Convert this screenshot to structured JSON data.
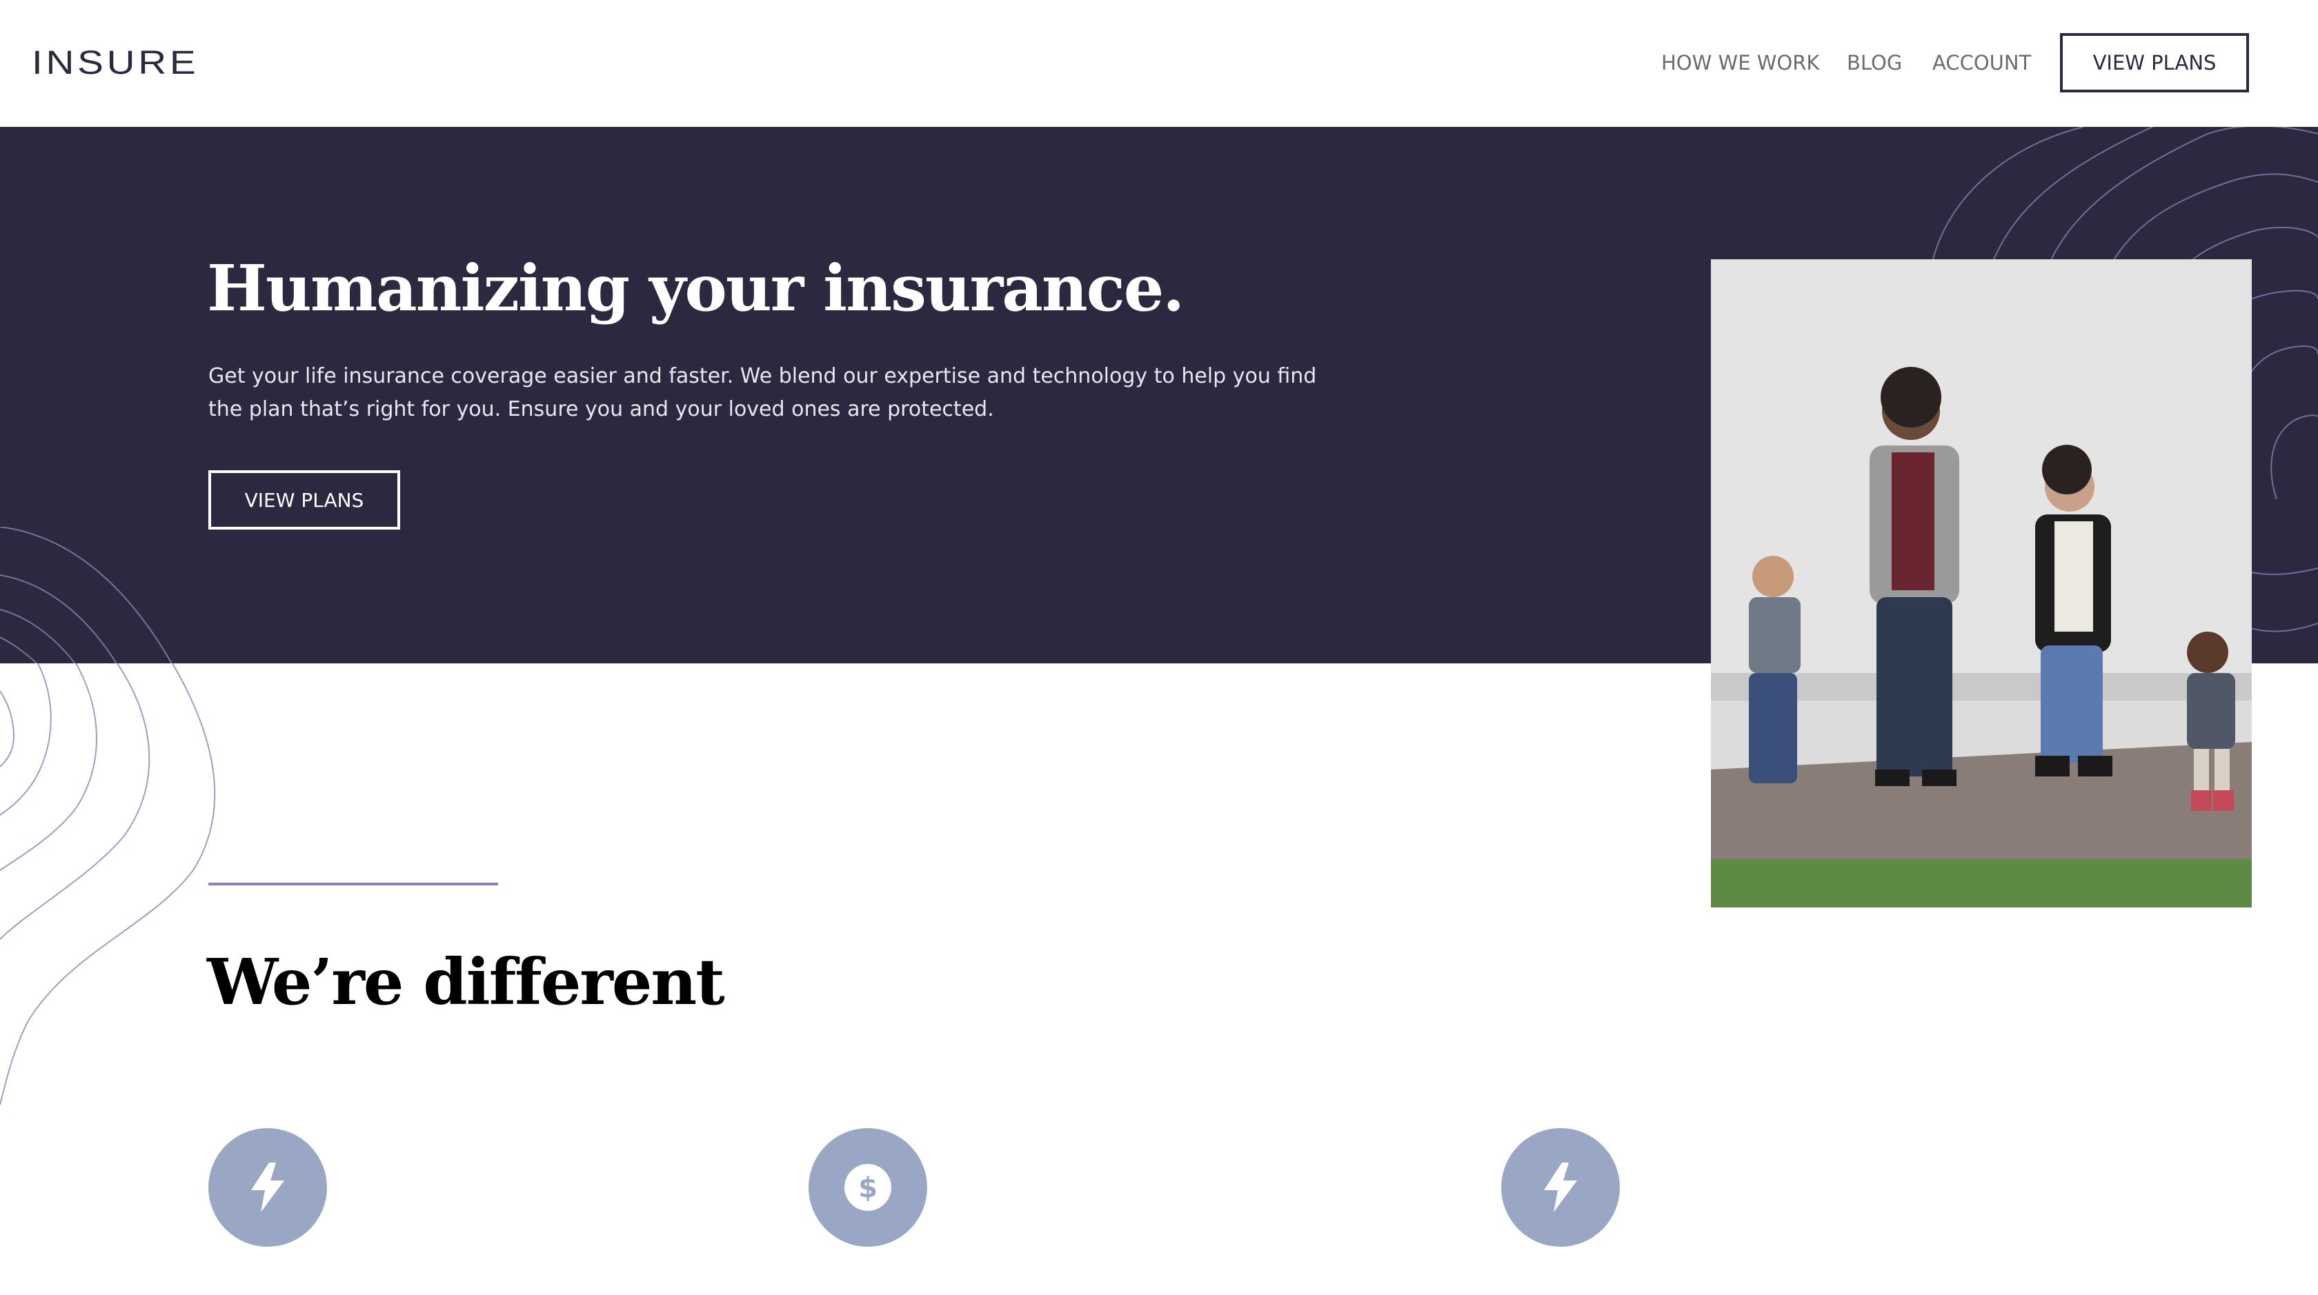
{
  "header": {
    "logo": "INSURE",
    "nav": [
      {
        "label": "HOW WE WORK"
      },
      {
        "label": "BLOG"
      },
      {
        "label": "ACCOUNT"
      }
    ],
    "cta_label": "VIEW PLANS"
  },
  "hero": {
    "title": "Humanizing your insurance.",
    "description": "Get your life insurance coverage easier and faster. We blend our expertise and technology to help you find the plan that’s right for you. Ensure you and your loved ones are protected.",
    "cta_label": "VIEW PLANS"
  },
  "section": {
    "title": "We’re different",
    "features": [
      {
        "icon": "lightning-icon"
      },
      {
        "icon": "dollar-icon"
      },
      {
        "icon": "lightning-icon"
      }
    ]
  },
  "colors": {
    "dark": "#2d2840",
    "accent": "#8c84b8",
    "icon_bg": "#9aa7c4",
    "nav_text": "#6b6b74"
  }
}
